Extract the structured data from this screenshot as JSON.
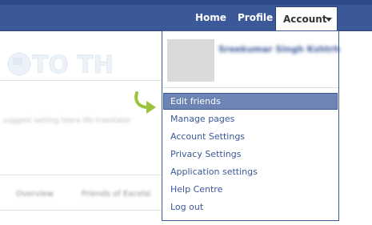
{
  "nav": {
    "home": "Home",
    "profile": "Profile",
    "account": "Account"
  },
  "background": {
    "logo_text": "TO THE PC",
    "status_text": "suggest setting teara life translator",
    "tabs": [
      "Overview",
      "Friends of Excelsi"
    ]
  },
  "dropdown": {
    "profile_name": "Sreekumar Singh Kshtrh",
    "items": [
      {
        "label": "Edit friends"
      },
      {
        "label": "Manage pages"
      },
      {
        "label": "Account Settings"
      },
      {
        "label": "Privacy Settings"
      },
      {
        "label": "Application settings"
      },
      {
        "label": "Help Centre"
      },
      {
        "label": "Log out"
      }
    ]
  },
  "colors": {
    "brand_blue": "#3b5998",
    "highlight": "#6d84b4",
    "arrow_green": "#9bc43a"
  }
}
